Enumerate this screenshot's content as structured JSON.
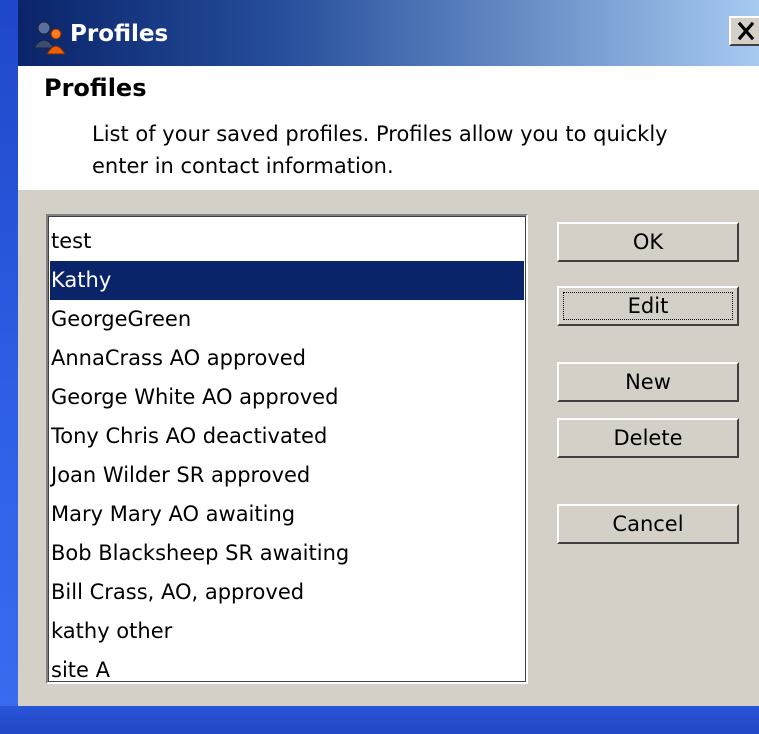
{
  "window": {
    "title": "Profiles",
    "close_label": "X"
  },
  "header": {
    "title": "Profiles",
    "description": "List of your saved profiles.  Profiles allow you to quickly enter in contact information."
  },
  "profiles": {
    "items": [
      {
        "label": "test"
      },
      {
        "label": "Kathy",
        "selected": true
      },
      {
        "label": "GeorgeGreen"
      },
      {
        "label": "AnnaCrass AO approved"
      },
      {
        "label": "George White AO approved"
      },
      {
        "label": "Tony Chris AO deactivated"
      },
      {
        "label": "Joan Wilder SR approved"
      },
      {
        "label": "Mary Mary AO awaiting"
      },
      {
        "label": "Bob Blacksheep SR awaiting"
      },
      {
        "label": "Bill Crass, AO, approved"
      },
      {
        "label": "kathy other"
      },
      {
        "label": "site A"
      }
    ]
  },
  "buttons": {
    "ok": "OK",
    "edit": "Edit",
    "new": "New",
    "delete": "Delete",
    "cancel": "Cancel"
  },
  "colors": {
    "selection": "#0a246a",
    "dialog_face": "#d4d0c8",
    "desktop": "#2a55d8"
  }
}
